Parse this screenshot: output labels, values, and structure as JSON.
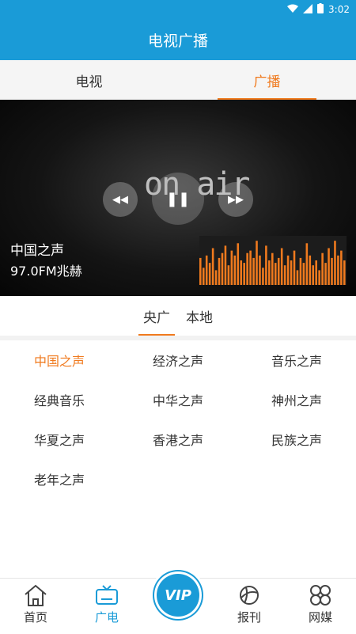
{
  "status_bar": {
    "time": "3:02"
  },
  "app_bar": {
    "title": "电视广播"
  },
  "top_tabs": [
    {
      "label": "电视",
      "active": false
    },
    {
      "label": "广播",
      "active": true
    }
  ],
  "player": {
    "station_name": "中国之声",
    "frequency": "97.0FM兆赫",
    "background_text": "on air",
    "equalizer_levels": [
      0.55,
      0.35,
      0.6,
      0.45,
      0.75,
      0.3,
      0.55,
      0.65,
      0.8,
      0.4,
      0.7,
      0.6,
      0.85,
      0.5,
      0.45,
      0.65,
      0.7,
      0.55,
      0.9,
      0.6,
      0.35,
      0.8,
      0.5,
      0.65,
      0.45,
      0.55,
      0.75,
      0.4,
      0.6,
      0.5,
      0.7,
      0.3,
      0.55,
      0.45,
      0.85,
      0.6,
      0.4,
      0.5,
      0.3,
      0.65,
      0.45,
      0.75,
      0.55,
      0.9,
      0.6,
      0.7,
      0.5
    ]
  },
  "sub_tabs": [
    {
      "label": "央广",
      "active": true
    },
    {
      "label": "本地",
      "active": false
    }
  ],
  "stations": [
    {
      "name": "中国之声",
      "active": true
    },
    {
      "name": "经济之声",
      "active": false
    },
    {
      "name": "音乐之声",
      "active": false
    },
    {
      "name": "经典音乐",
      "active": false
    },
    {
      "name": "中华之声",
      "active": false
    },
    {
      "name": "神州之声",
      "active": false
    },
    {
      "name": "华夏之声",
      "active": false
    },
    {
      "name": "香港之声",
      "active": false
    },
    {
      "name": "民族之声",
      "active": false
    },
    {
      "name": "老年之声",
      "active": false
    }
  ],
  "bottom_nav": {
    "home": "首页",
    "radio": "广电",
    "vip": "VIP",
    "newspaper": "报刊",
    "media": "网媒"
  },
  "colors": {
    "primary": "#1a9bd7",
    "accent": "#f07a1e"
  }
}
